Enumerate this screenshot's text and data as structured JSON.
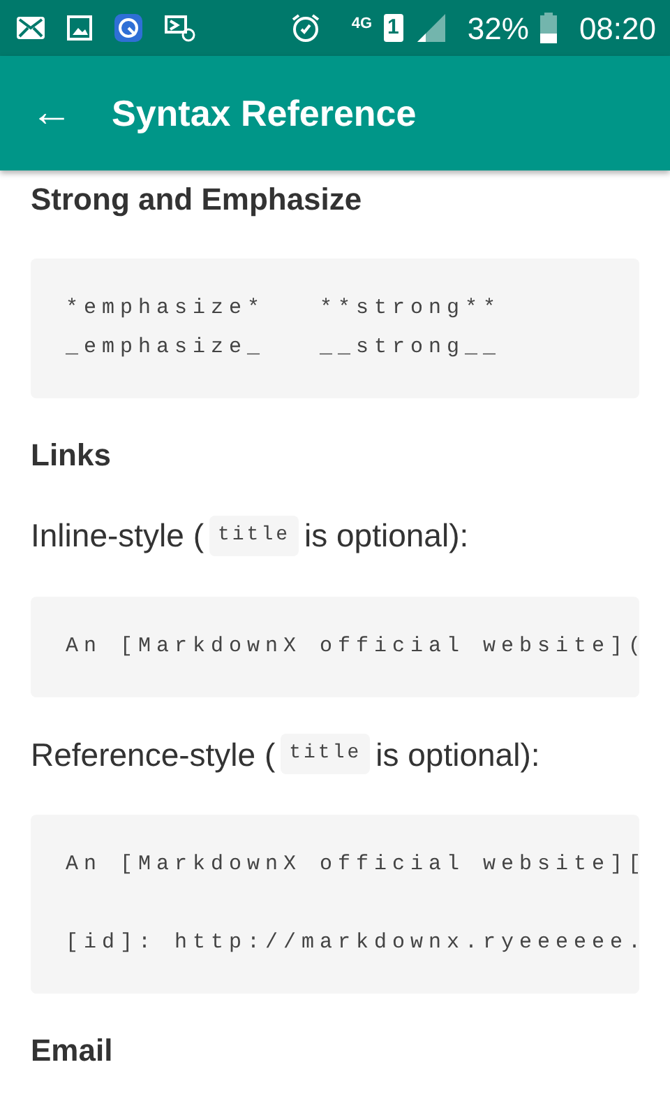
{
  "status_bar": {
    "network": "4G",
    "sim": "1",
    "battery": "32%",
    "time": "08:20"
  },
  "app_bar": {
    "back": "←",
    "title": "Syntax Reference"
  },
  "content": [
    {
      "kind": "heading",
      "text": "Strong and Emphasize"
    },
    {
      "kind": "code",
      "groups": [
        [
          "*emphasize*   **strong**",
          "_emphasize_   __strong__"
        ]
      ]
    },
    {
      "kind": "heading",
      "text": "Links"
    },
    {
      "kind": "paragraph",
      "parts": [
        {
          "text": "Inline-style ("
        },
        {
          "text": "title",
          "inline_code": true
        },
        {
          "text": "is optional):"
        }
      ]
    },
    {
      "kind": "code",
      "groups": [
        [
          "An [MarkdownX official website]("
        ]
      ]
    },
    {
      "kind": "paragraph",
      "parts": [
        {
          "text": "Reference-style ("
        },
        {
          "text": "title",
          "inline_code": true
        },
        {
          "text": "is optional):"
        }
      ]
    },
    {
      "kind": "code",
      "groups": [
        [
          "An [MarkdownX official website]["
        ],
        [
          "[id]: http://markdownx.ryeeeeee."
        ]
      ]
    },
    {
      "kind": "heading",
      "text": "Email"
    }
  ]
}
